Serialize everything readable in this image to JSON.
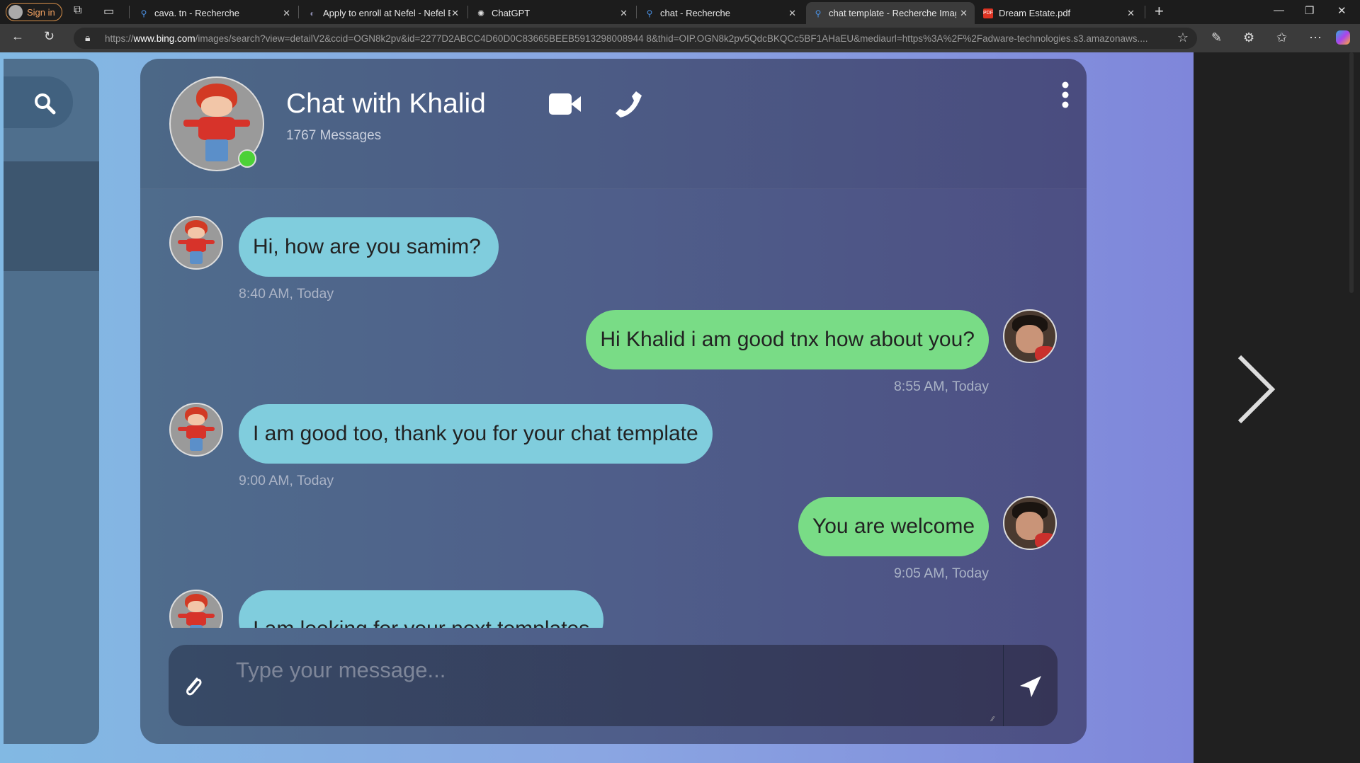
{
  "browser": {
    "sign_in": "Sign in",
    "tabs": [
      {
        "label": "cava. tn - Recherche"
      },
      {
        "label": "Apply to enroll at Nefel - Nefel Ed"
      },
      {
        "label": "ChatGPT"
      },
      {
        "label": "chat - Recherche"
      },
      {
        "label": "chat template - Recherche Images"
      },
      {
        "label": "Dream Estate.pdf"
      }
    ],
    "url_domain": "www.bing.com",
    "url_prefix": "https://",
    "url_rest": "/images/search?view=detailV2&ccid=OGN8k2pv&id=2277D2ABCC4D60D0C83665BEEB5913298008944 8&thid=OIP.OGN8k2pv5QdcBKQCc5BF1AHaEU&mediaurl=https%3A%2F%2Fadware-technologies.s3.amazonaws...."
  },
  "chat": {
    "title": "Chat with Khalid",
    "message_count": "1767 Messages",
    "messages": [
      {
        "from": "khalid",
        "text": "Hi, how are you samim?",
        "time": "8:40 AM, Today"
      },
      {
        "from": "me",
        "text": "Hi Khalid i am good tnx how about you?",
        "time": "8:55 AM, Today"
      },
      {
        "from": "khalid",
        "text": "I am good too, thank you for your chat template",
        "time": "9:00 AM, Today"
      },
      {
        "from": "me",
        "text": "You are welcome",
        "time": "9:05 AM, Today"
      },
      {
        "from": "khalid",
        "text": "I am looking for your next templates"
      }
    ],
    "input_placeholder": "Type your message..."
  },
  "colors": {
    "incoming": "#80cddd",
    "outgoing": "#79dc86",
    "online": "#4cd137"
  }
}
